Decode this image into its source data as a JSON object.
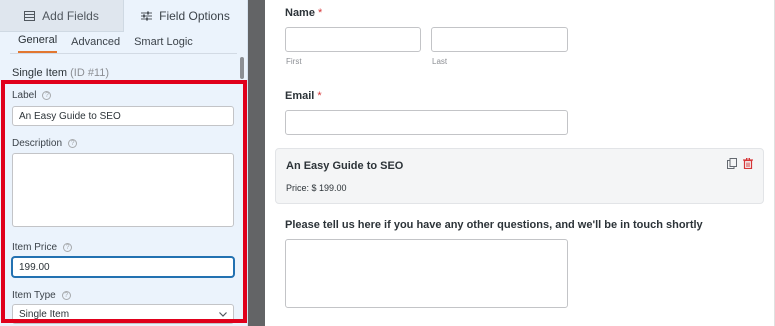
{
  "left_panel": {
    "tabs": [
      {
        "label": "Add Fields",
        "icon": "add-fields-icon"
      },
      {
        "label": "Field Options",
        "icon": "sliders-icon"
      }
    ],
    "sub_tabs": [
      "General",
      "Advanced",
      "Smart Logic"
    ],
    "item_title": "Single Item",
    "item_id": "(ID #11)",
    "label_field": {
      "label": "Label",
      "value": "An Easy Guide to SEO"
    },
    "description_field": {
      "label": "Description",
      "value": ""
    },
    "price_field": {
      "label": "Item Price",
      "value": "199.00"
    },
    "type_field": {
      "label": "Item Type",
      "value": "Single Item"
    },
    "help_glyph": "?"
  },
  "preview": {
    "name": {
      "label": "Name",
      "required": "*",
      "first": "First",
      "last": "Last"
    },
    "email": {
      "label": "Email",
      "required": "*"
    },
    "item": {
      "title": "An Easy Guide to SEO",
      "price": "Price: $ 199.00"
    },
    "question": {
      "label": "Please tell us here if you have any other questions, and we'll be in touch shortly"
    }
  },
  "colors": {
    "highlight": "#e0001b",
    "active_tab_underline": "#e27730",
    "required": "#d63638"
  }
}
